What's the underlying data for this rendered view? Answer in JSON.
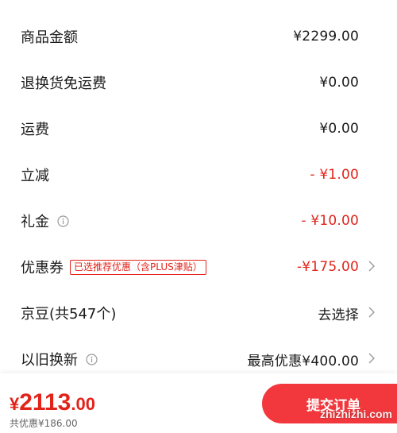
{
  "rows": [
    {
      "label": "商品金额",
      "value": "¥2299.00"
    },
    {
      "label": "退换货免运费",
      "value": "¥0.00"
    },
    {
      "label": "运费",
      "value": "¥0.00"
    },
    {
      "label": "立减",
      "value": "- ¥1.00"
    },
    {
      "label": "礼金",
      "value": "- ¥10.00"
    },
    {
      "label": "优惠券",
      "tag": "已选推荐优惠（含PLUS津贴）",
      "value": "-¥175.00"
    },
    {
      "label": "京豆(共547个)",
      "value": "去选择"
    },
    {
      "label": "以旧换新",
      "value": "最高优惠¥400.00"
    }
  ],
  "footer": {
    "currency": "¥",
    "total_int": "2113",
    "total_dec": ".00",
    "saved": "共优惠¥186.00",
    "submit_label": "提交订单"
  },
  "watermark": "zhizhizhi.com",
  "colors": {
    "accent_red": "#e2231a",
    "button_red": "#f2383d",
    "text": "#1a1a1a",
    "muted": "#999999"
  },
  "icons": {
    "info": "info-circle-icon",
    "chevron": "chevron-right-icon"
  }
}
